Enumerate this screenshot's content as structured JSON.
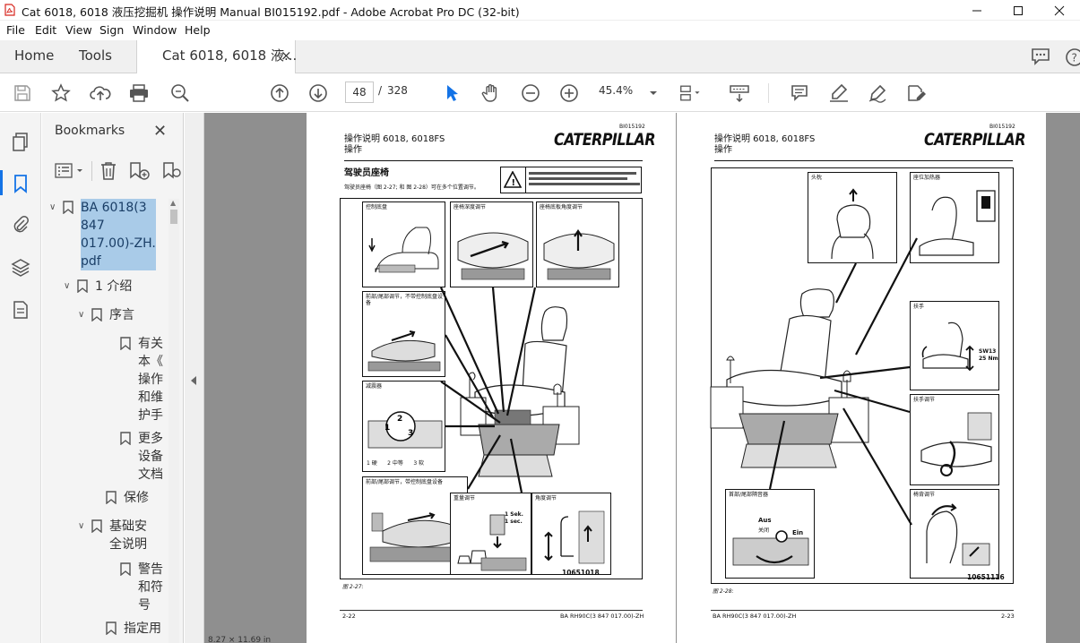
{
  "window": {
    "title": "Cat 6018, 6018 液压挖掘机 操作说明 Manual BI015192.pdf - Adobe Acrobat Pro DC (32-bit)"
  },
  "menu": [
    "File",
    "Edit",
    "View",
    "Sign",
    "Window",
    "Help"
  ],
  "tabs": {
    "home": "Home",
    "tools": "Tools",
    "document": "Cat 6018, 6018 液...",
    "close": "×"
  },
  "toolbar": {
    "current_page": "48",
    "separator": "/",
    "total_pages": "328",
    "zoom": "45.4%"
  },
  "bookmarks": {
    "title": "Bookmarks",
    "close": "✕",
    "items": [
      {
        "label": "BA 6018(3 847 017.00)-ZH.pdf",
        "lines": [
          "BA 6018(3",
          "847",
          "017.00)-ZH.",
          "pdf"
        ]
      },
      {
        "label": "1 介绍",
        "lines": [
          "1 介绍"
        ]
      },
      {
        "label": "序言",
        "lines": [
          "序言"
        ]
      },
      {
        "label": "有关本《操作和维护手",
        "lines": [
          "有关",
          "本《",
          "操作",
          "和维",
          "护手"
        ]
      },
      {
        "label": "更多设备文档",
        "lines": [
          "更多",
          "设备",
          "文档"
        ]
      },
      {
        "label": "保修",
        "lines": [
          "保修"
        ]
      },
      {
        "label": "基础安全说明",
        "lines": [
          "基础安",
          "全说明"
        ]
      },
      {
        "label": "警告和符号",
        "lines": [
          "警告",
          "和符",
          "号"
        ]
      },
      {
        "label": "指定用",
        "lines": [
          "指定用"
        ]
      }
    ]
  },
  "left_page": {
    "doc_number": "BI015192",
    "header_line1": "操作说明  6018, 6018FS",
    "header_line2": "操作",
    "logo": "CATERPILLAR",
    "section_title": "驾驶员座椅",
    "intro": "驾驶员座椅（图 2-27; 和 图 2-28）可在多个位置调节。",
    "panels": {
      "p1": "控制底盘",
      "p2": "座椅深度调节",
      "p3": "座椅底板角度调节",
      "p4": "前部/尾部调节，不带控制底盘设备",
      "p5": "减震器",
      "p5_legend": "1 硬      2 中等      3 软",
      "p6": "前部/尾部调节，带控制底盘设备",
      "p7": "重量调节",
      "p8": "角度调节",
      "p7_note": "1 Sek.\n1 sec."
    },
    "figure_id": "10651018",
    "caption": "图 2-27:",
    "footer_left": "2-22",
    "footer_right": "BA RH90C(3 847 017.00)-ZH"
  },
  "right_page": {
    "doc_number": "BI015192",
    "header_line1": "操作说明  6018, 6018FS",
    "header_line2": "操作",
    "logo": "CATERPILLAR",
    "panels": {
      "p1": "头枕",
      "p2": "座位加热器",
      "p3": "扶手",
      "p3_note": "SW13\n25 Nm",
      "p4": "扶手调节",
      "p5": "首部/尾部隔音器",
      "p5_aus": "Aus",
      "p5_aus_zh": "关闭",
      "p5_ein": "Ein",
      "p5_ein_zh": "打开",
      "p6": "椅背调节"
    },
    "figure_id": "10651116",
    "caption": "图 2-28:",
    "footer_left": "BA RH90C(3 847 017.00)-ZH",
    "footer_right": "2-23"
  },
  "status_fragment": "8.27 × 11.69 in",
  "colors": {
    "accent": "#1473e6",
    "selection": "#a9cbe8",
    "doc_background": "#8f8f8f"
  }
}
